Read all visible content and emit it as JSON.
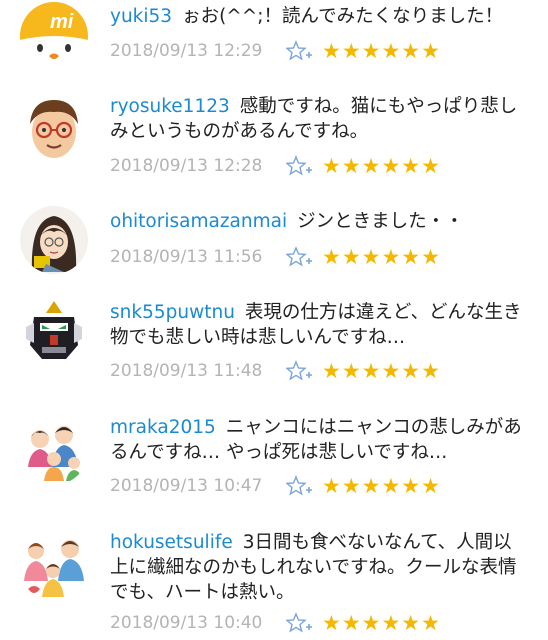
{
  "comments": [
    {
      "username": "yuki53",
      "text": "ぉお(^^;！読んでみたくなりました！",
      "timestamp": "2018/09/13 12:29",
      "stars": "★★★★★★",
      "avatar_icon": "yellow-chick-mi-icon"
    },
    {
      "username": "ryosuke1123",
      "text": "感動ですね。猫にもやっぱり悲しみというものがあるんですね。",
      "timestamp": "2018/09/13 12:28",
      "stars": "★★★★★★",
      "avatar_icon": "glasses-man-icon"
    },
    {
      "username": "ohitorisamazanmai",
      "text": "ジンときました・・",
      "timestamp": "2018/09/13 11:56",
      "stars": "★★★★★★",
      "avatar_icon": "woman-illustration-icon"
    },
    {
      "username": "snk55puwtnu",
      "text": "表現の仕方は違えど、どんな生き物でも悲しい時は悲しいんですね…",
      "timestamp": "2018/09/13 11:48",
      "stars": "★★★★★★",
      "avatar_icon": "robot-head-icon"
    },
    {
      "username": "mraka2015",
      "text": "ニャンコにはニャンコの悲しみがあるんですね… やっぱ死は悲しいですね…",
      "timestamp": "2018/09/13 10:47",
      "stars": "★★★★★★",
      "avatar_icon": "family-illustration-icon"
    },
    {
      "username": "hokusetsulife",
      "text": "3日間も食べないなんて、人間以上に繊細なのかもしれないですね。クールな表情でも、ハートは熱い。",
      "timestamp": "2018/09/13 10:40",
      "stars": "★★★★★★",
      "avatar_icon": "family-group-icon"
    }
  ],
  "colors": {
    "username": "#1c8ad1",
    "text": "#222222",
    "timestamp": "#b4b4b4",
    "star": "#f5b800",
    "fav_icon": "#7aa6d6"
  }
}
